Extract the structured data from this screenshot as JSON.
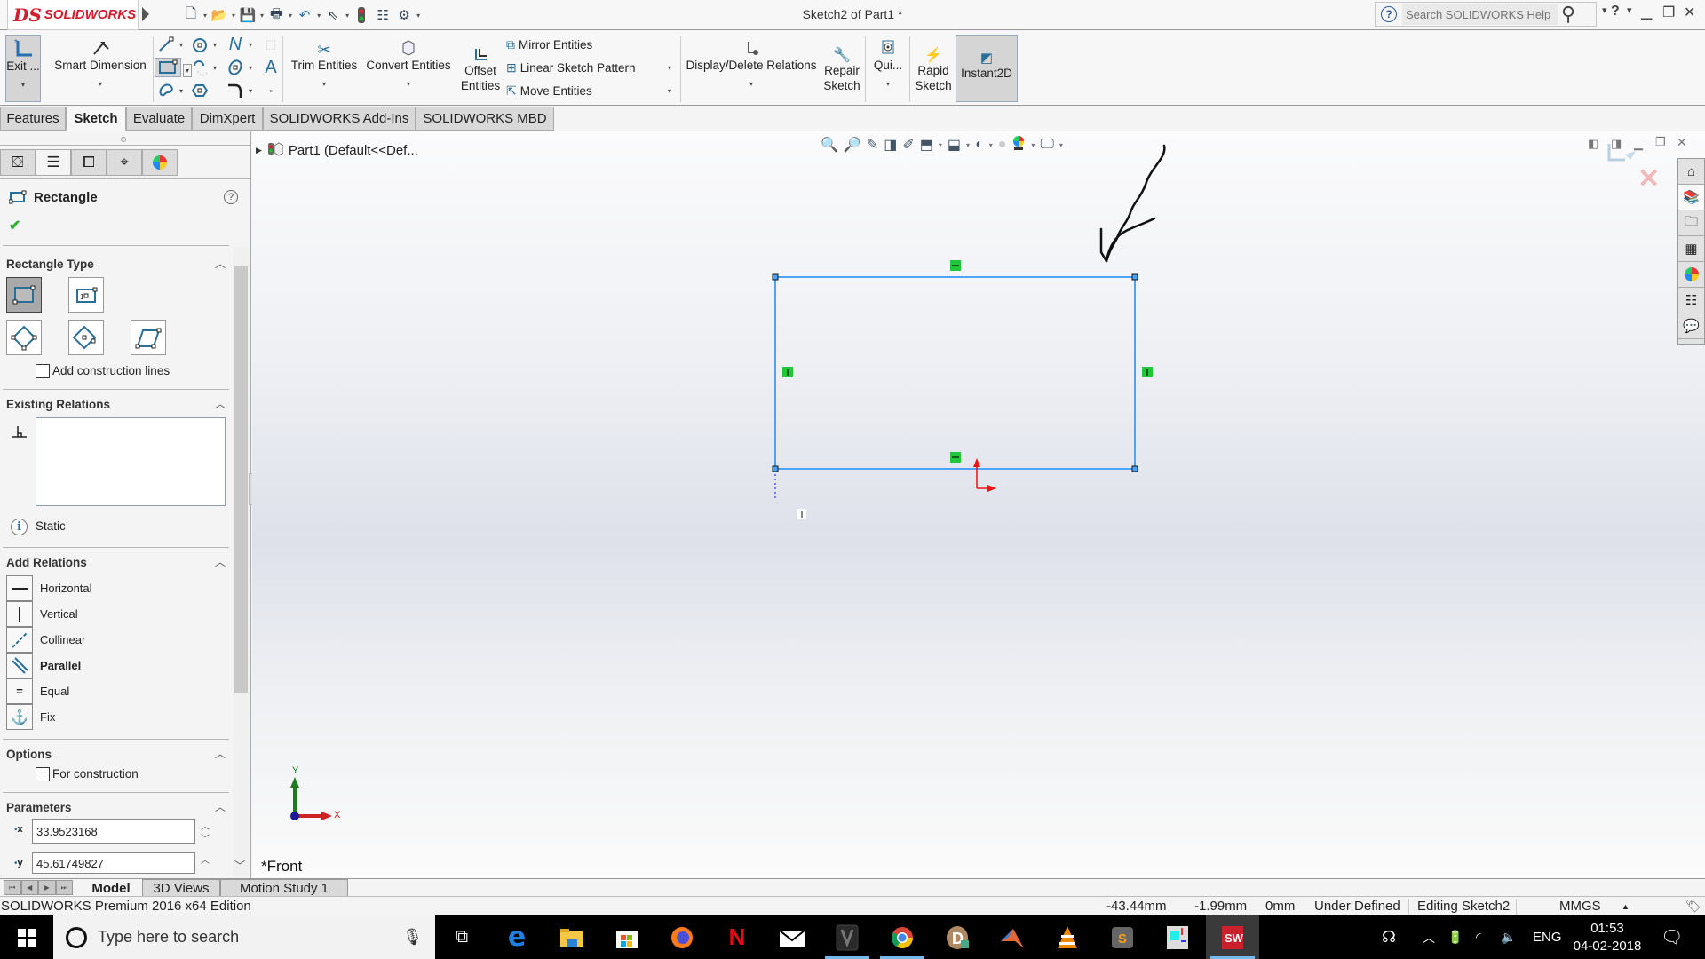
{
  "app": {
    "brand": "SOLIDWORKS",
    "brand_ds": "DS",
    "document_title": "Sketch2 of Part1 *",
    "help_search_placeholder": "Search SOLIDWORKS Help"
  },
  "quick_access": [
    "new-document",
    "open",
    "save",
    "print",
    "undo",
    "select",
    "rebuild",
    "file-properties",
    "options"
  ],
  "command_manager": {
    "exit_sketch": "Exit ...",
    "smart_dimension": "Smart Dimension",
    "trim_entities": "Trim Entities",
    "convert_entities": "Convert Entities",
    "offset_entities_1": "Offset",
    "offset_entities_2": "Entities",
    "mirror_entities": "Mirror Entities",
    "linear_sketch_pattern": "Linear Sketch Pattern",
    "move_entities": "Move Entities",
    "display_delete_relations": "Display/Delete Relations",
    "repair_sketch_1": "Repair",
    "repair_sketch_2": "Sketch",
    "quick_snaps": "Qui...",
    "rapid_sketch_1": "Rapid",
    "rapid_sketch_2": "Sketch",
    "instant2d": "Instant2D"
  },
  "cm_tabs": [
    {
      "label": "Features",
      "active": false
    },
    {
      "label": "Sketch",
      "active": true
    },
    {
      "label": "Evaluate",
      "active": false
    },
    {
      "label": "DimXpert",
      "active": false
    },
    {
      "label": "SOLIDWORKS Add-Ins",
      "active": false
    },
    {
      "label": "SOLIDWORKS MBD",
      "active": false
    }
  ],
  "property_manager": {
    "title": "Rectangle",
    "rectangle_type": {
      "header": "Rectangle Type",
      "options": [
        "corner-rectangle",
        "center-rectangle",
        "3-point-corner-rectangle",
        "3-point-center-rectangle",
        "parallelogram"
      ],
      "selected": "corner-rectangle",
      "add_construction_lines_label": "Add construction lines",
      "add_construction_lines_checked": false
    },
    "existing_relations": {
      "header": "Existing Relations",
      "items": [],
      "status": "Static"
    },
    "add_relations": {
      "header": "Add Relations",
      "items": [
        {
          "label": "Horizontal",
          "bold": false
        },
        {
          "label": "Vertical",
          "bold": false
        },
        {
          "label": "Collinear",
          "bold": false
        },
        {
          "label": "Parallel",
          "bold": true
        },
        {
          "label": "Equal",
          "bold": false
        },
        {
          "label": "Fix",
          "bold": false
        }
      ]
    },
    "options": {
      "header": "Options",
      "for_construction_label": "For construction",
      "for_construction_checked": false
    },
    "parameters": {
      "header": "Parameters",
      "x": "33.9523168",
      "y": "45.61749827"
    }
  },
  "graphics": {
    "tree_root": "Part1  (Default<<Def...",
    "view_label": "*Front",
    "triad": {
      "x": "X",
      "y": "Y"
    }
  },
  "bottom_tabs": [
    {
      "label": "Model",
      "active": true
    },
    {
      "label": "3D Views",
      "active": false
    },
    {
      "label": "Motion Study 1",
      "active": false
    }
  ],
  "status_bar": {
    "edition": "SOLIDWORKS Premium 2016 x64 Edition",
    "x": "-43.44mm",
    "y": "-1.99mm",
    "z": "0mm",
    "definition": "Under Defined",
    "editing": "Editing Sketch2",
    "units": "MMGS"
  },
  "taskbar": {
    "search_placeholder": "Type here to search",
    "language": "ENG",
    "time": "01:53",
    "date": "04-02-2018"
  },
  "colors": {
    "sketch_line": "#4da3f5",
    "relation_badge": "#1ec83a",
    "brand_red": "#d0202f"
  }
}
